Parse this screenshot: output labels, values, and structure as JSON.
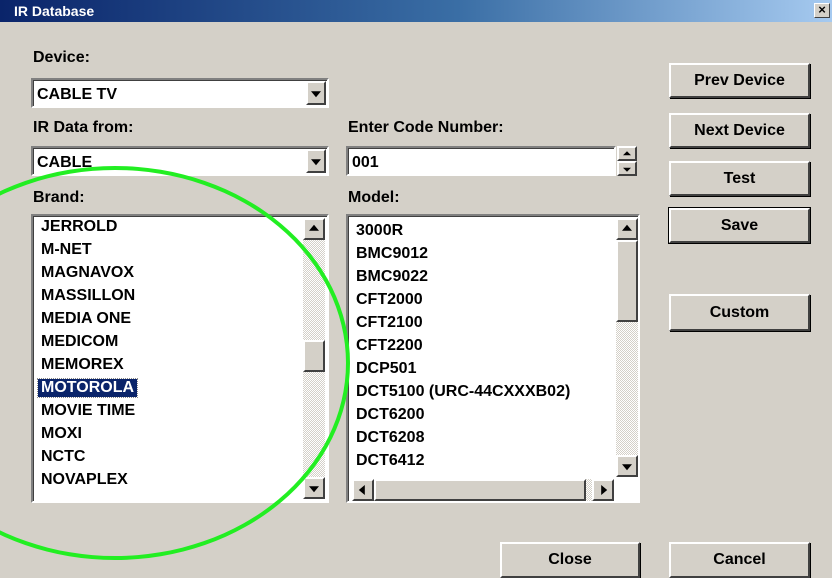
{
  "window": {
    "title": "IR Database",
    "close_glyph": "×"
  },
  "device": {
    "label": "Device:",
    "value": "CABLE TV"
  },
  "ir_data": {
    "label": "IR Data from:",
    "value": "CABLE"
  },
  "code": {
    "label": "Enter Code Number:",
    "value": "001"
  },
  "brand": {
    "label": "Brand:",
    "items": [
      "JERROLD",
      "M-NET",
      "MAGNAVOX",
      "MASSILLON",
      "MEDIA ONE",
      "MEDICOM",
      "MEMOREX",
      "MOTOROLA",
      "MOVIE TIME",
      "MOXI",
      "NCTC",
      "NOVAPLEX"
    ],
    "selected": "MOTOROLA"
  },
  "model": {
    "label": "Model:",
    "items": [
      "3000R",
      "BMC9012",
      "BMC9022",
      "CFT2000",
      "CFT2100",
      "CFT2200",
      "DCP501",
      "DCT5100 (URC-44CXXXB02)",
      "DCT6200",
      "DCT6208",
      "DCT6412"
    ]
  },
  "buttons": {
    "prev_device": "Prev Device",
    "next_device": "Next Device",
    "test": "Test",
    "save": "Save",
    "custom": "Custom",
    "close": "Close",
    "cancel": "Cancel"
  },
  "colors": {
    "highlight_circle": "#22ee22",
    "selection": "#0a246a",
    "face": "#d4d0c8"
  }
}
